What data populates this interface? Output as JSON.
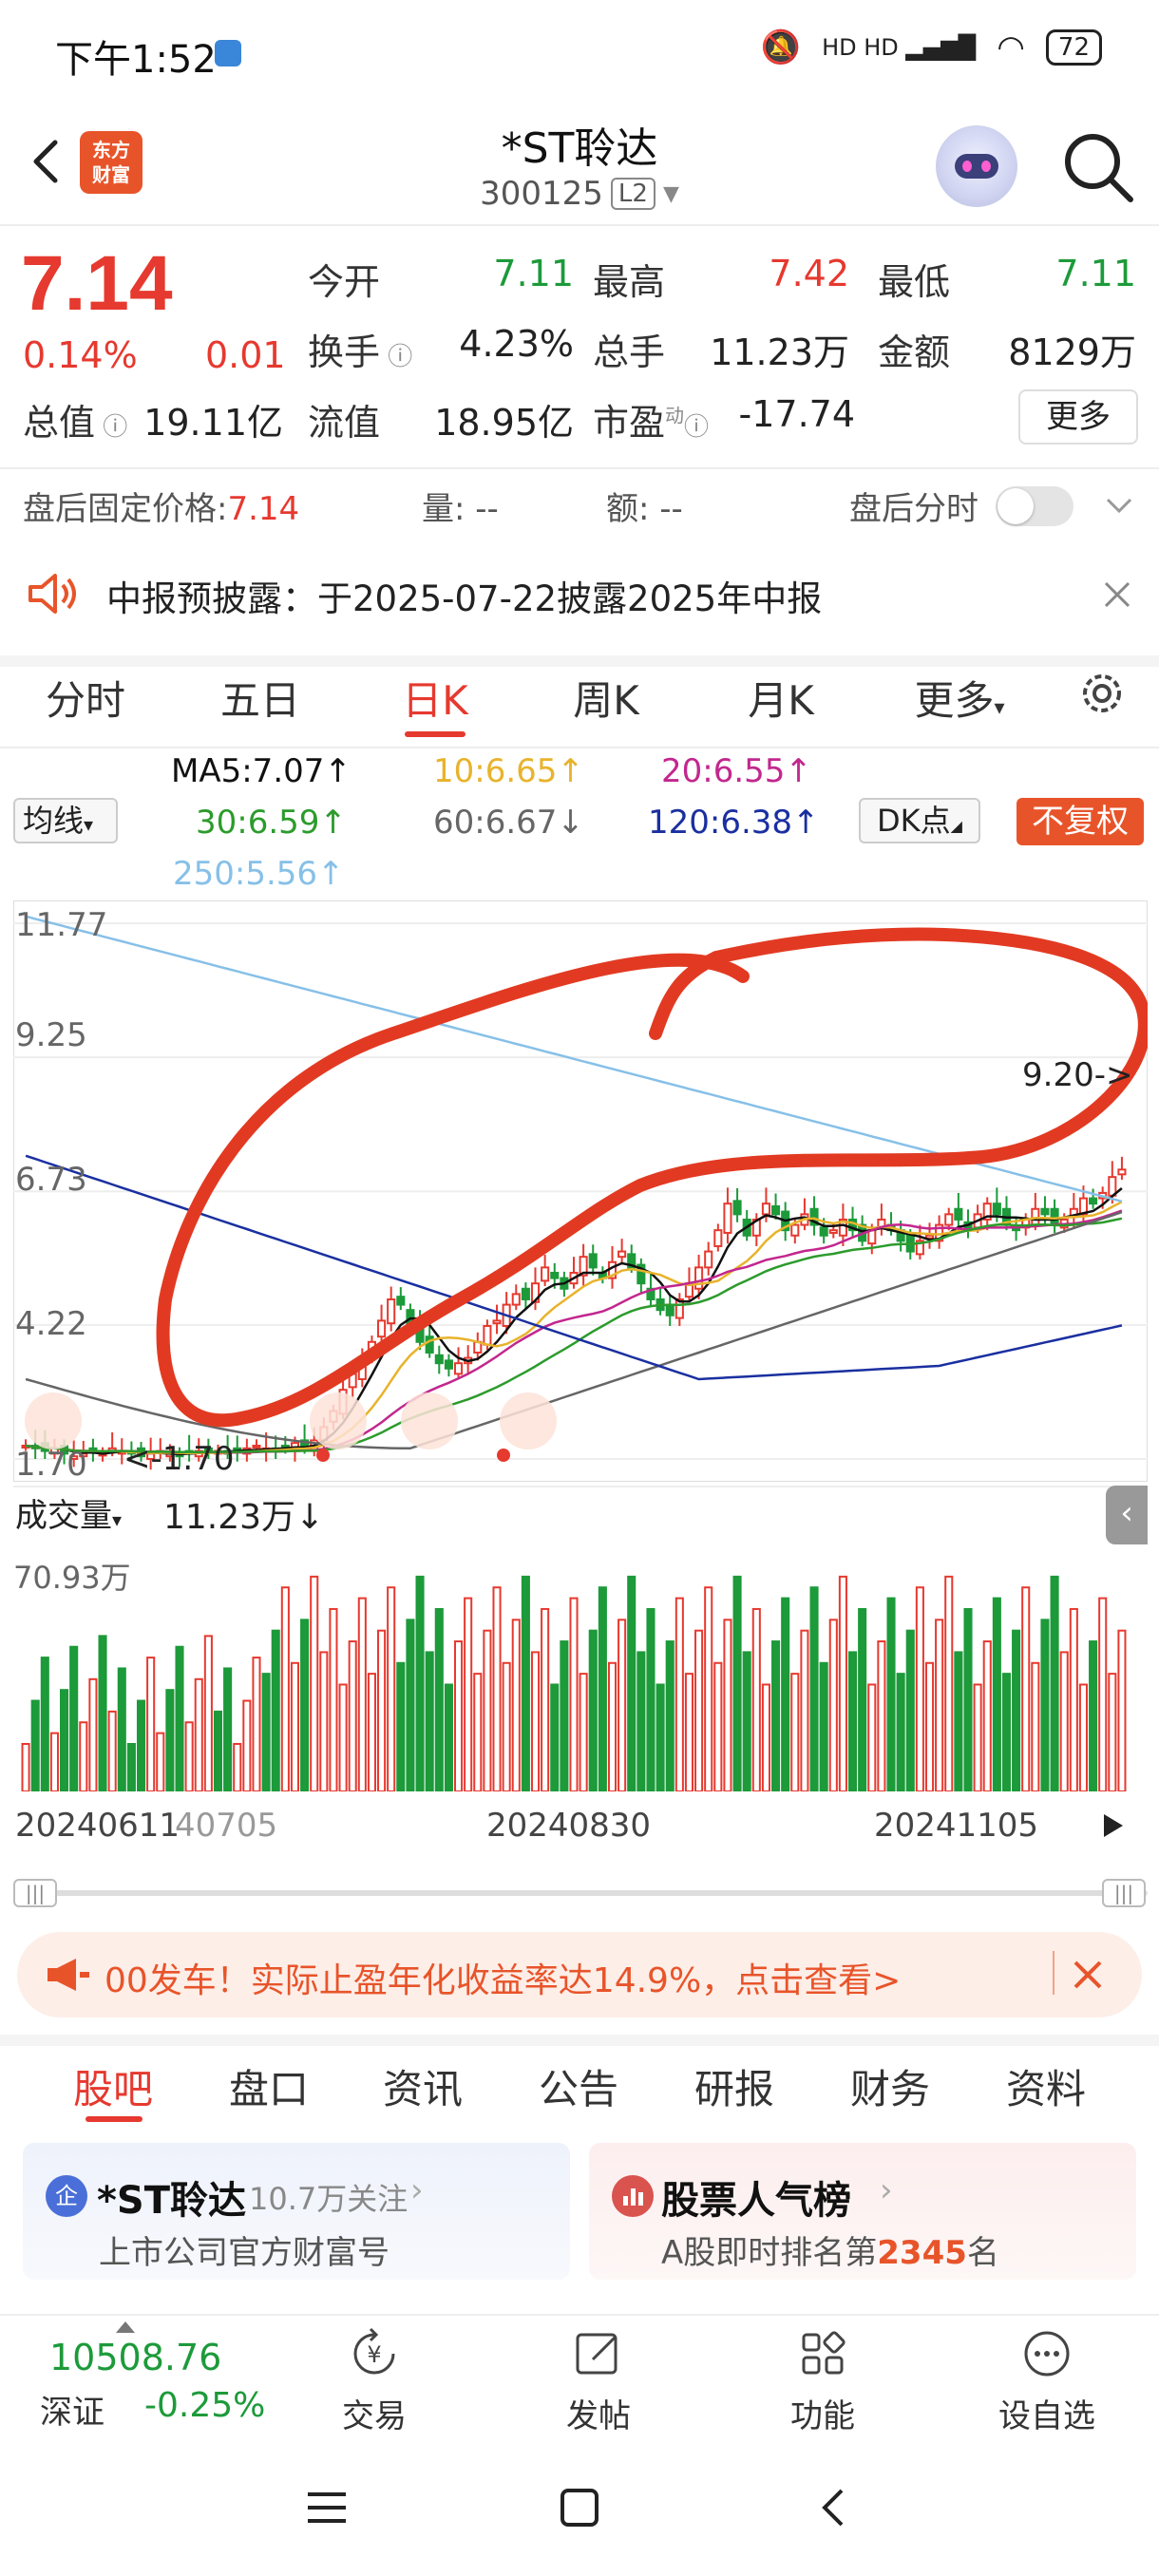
{
  "status_bar": {
    "time": "下午1:52",
    "network_icons": "HD HD",
    "battery": "72"
  },
  "header": {
    "logo_text_line1": "东方",
    "logo_text_line2": "财富",
    "title": "*ST聆达",
    "code": "300125",
    "level": "L2"
  },
  "quote": {
    "price": "7.14",
    "change_pct": "0.14%",
    "change_val": "0.01",
    "open_label": "今开",
    "open": "7.11",
    "high_label": "最高",
    "high": "7.42",
    "low_label": "最低",
    "low": "7.11",
    "turnover_label": "换手",
    "turnover": "4.23%",
    "volume_label": "总手",
    "volume": "11.23万",
    "amount_label": "金额",
    "amount": "8129万",
    "mcap_label": "总值",
    "mcap": "19.11亿",
    "float_label": "流值",
    "float": "18.95亿",
    "pe_label": "市盈",
    "pe_sup": "动",
    "pe": "-17.74",
    "more": "更多"
  },
  "after_hours": {
    "price_label": "盘后固定价格:",
    "price": "7.14",
    "vol_label": "量:",
    "vol": "--",
    "amt_label": "额:",
    "amt": "--",
    "timeshare_label": "盘后分时"
  },
  "notice": {
    "text": "中报预披露：于2025-07-22披露2025年中报"
  },
  "chart_tabs": [
    "分时",
    "五日",
    "日K",
    "周K",
    "月K",
    "更多"
  ],
  "ma_legend": {
    "select": "均线",
    "ma5": "MA5:7.07↑",
    "ma10": "10:6.65↑",
    "ma20": "20:6.55↑",
    "ma30": "30:6.59↑",
    "ma60": "60:6.67↓",
    "ma120": "120:6.38↑",
    "ma250": "250:5.56↑",
    "dk": "DK点",
    "adjust": "不复权"
  },
  "colors": {
    "up": "#e6392f",
    "down": "#1d9a3a",
    "ma5": "#111111",
    "ma10": "#e8b32c",
    "ma20": "#c2278e",
    "ma30": "#2c9b2c",
    "ma60": "#666666",
    "ma120": "#1a2fa0",
    "ma250": "#86c0e8",
    "annotation": "#e23a22"
  },
  "kline": {
    "y_ticks": [
      "11.77",
      "9.25",
      "6.73",
      "4.22",
      "1.70"
    ],
    "min_label": "<-1.70",
    "max_label": "9.20->"
  },
  "volume": {
    "select": "成交量",
    "value": "11.23万↓",
    "max": "70.93万"
  },
  "dates": {
    "d1": "20240611",
    "d2": "40705",
    "d3": "20240830",
    "d4": "20241105"
  },
  "promo": {
    "text": "00发车！实际止盈年化收益率达14.9%，点击查看>"
  },
  "bottom_tabs": [
    "股吧",
    "盘口",
    "资讯",
    "公告",
    "研报",
    "财务",
    "资料"
  ],
  "cards": {
    "left_badge": "企",
    "left_title": "*ST聆达",
    "left_follow": "10.7万关注",
    "left_sub": "上市公司官方财富号",
    "right_title": "股票人气榜",
    "right_sub_prefix": "A股即时排名第",
    "right_rank": "2345",
    "right_sub_suffix": "名"
  },
  "footer": {
    "index_value": "10508.76",
    "index_name": "深证",
    "index_change": "-0.25%",
    "items": [
      "交易",
      "发帖",
      "功能",
      "设自选"
    ]
  },
  "chart_data": {
    "type": "candlestick",
    "title": "",
    "y_ticks": [
      11.77,
      9.25,
      6.73,
      4.22,
      1.7
    ],
    "ylim": [
      1.7,
      11.77
    ],
    "x_tick_labels": [
      "20240611",
      "40705",
      "20240830",
      "20241105"
    ],
    "series": [
      {
        "name": "MA5",
        "last": 7.07
      },
      {
        "name": "10",
        "last": 6.65
      },
      {
        "name": "20",
        "last": 6.55
      },
      {
        "name": "30",
        "last": 6.59
      },
      {
        "name": "60",
        "last": 6.67
      },
      {
        "name": "120",
        "last": 6.38
      },
      {
        "name": "250",
        "last": 5.56
      }
    ],
    "close": [
      1.95,
      1.9,
      1.85,
      1.9,
      1.8,
      1.75,
      1.8,
      1.85,
      1.8,
      1.9,
      1.85,
      1.8,
      1.75,
      1.8,
      1.85,
      1.8,
      1.75,
      1.8,
      1.85,
      1.9,
      1.85,
      1.8,
      1.85,
      1.9,
      1.95,
      1.9,
      1.85,
      1.9,
      2.0,
      1.95,
      2.05,
      2.3,
      2.6,
      3.0,
      3.3,
      3.6,
      3.9,
      4.3,
      4.7,
      4.6,
      4.2,
      3.9,
      3.7,
      3.5,
      3.4,
      3.5,
      3.6,
      3.9,
      4.2,
      4.3,
      4.6,
      4.8,
      4.7,
      5.0,
      5.3,
      5.1,
      4.9,
      5.2,
      5.5,
      5.3,
      5.1,
      5.4,
      5.6,
      5.3,
      5.0,
      4.7,
      4.5,
      4.4,
      4.7,
      5.0,
      5.3,
      5.6,
      6.0,
      6.5,
      6.3,
      5.9,
      6.2,
      6.5,
      6.3,
      6.0,
      6.1,
      6.3,
      6.1,
      5.9,
      6.0,
      6.2,
      6.0,
      5.8,
      6.0,
      6.2,
      6.0,
      5.8,
      5.6,
      5.8,
      5.9,
      6.1,
      6.3,
      6.2,
      6.0,
      6.3,
      6.5,
      6.3,
      6.1,
      6.0,
      6.2,
      6.4,
      6.3,
      6.1,
      6.2,
      6.4,
      6.6,
      6.5,
      6.7,
      7.0,
      7.14
    ],
    "volume_max": "70.93万",
    "volume_last": "11.23万"
  }
}
